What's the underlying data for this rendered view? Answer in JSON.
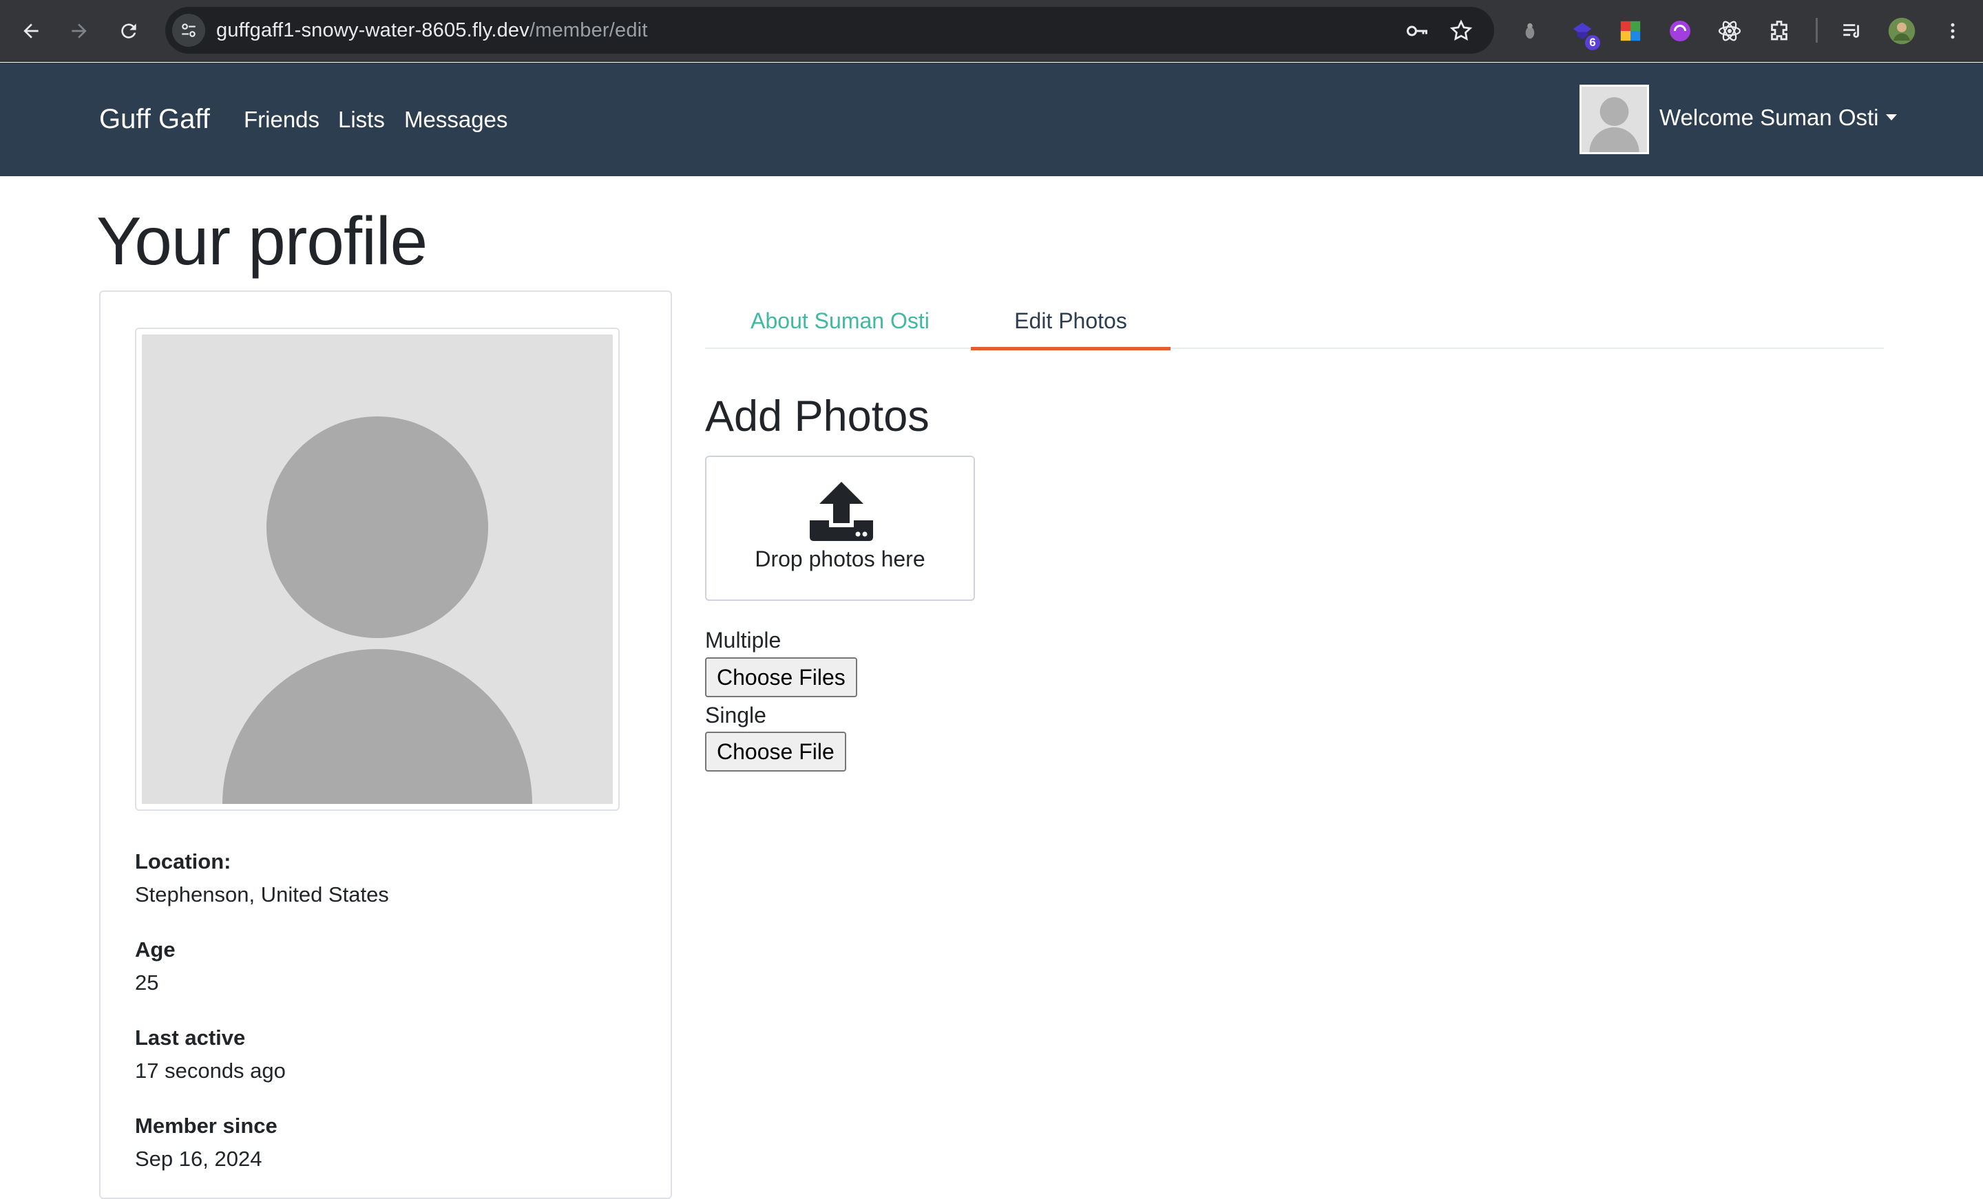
{
  "browser": {
    "url_host": "guffgaff1-snowy-water-8605.fly.dev",
    "url_path": "/member/edit",
    "extension_badge": "6"
  },
  "navbar": {
    "brand": "Guff Gaff",
    "links": [
      "Friends",
      "Lists",
      "Messages"
    ],
    "welcome": "Welcome Suman Osti"
  },
  "page": {
    "title": "Your profile"
  },
  "profile": {
    "location_label": "Location:",
    "location_value": "Stephenson, United States",
    "age_label": "Age",
    "age_value": "25",
    "last_active_label": "Last active",
    "last_active_value": "17 seconds ago",
    "member_since_label": "Member since",
    "member_since_value": "Sep 16, 2024"
  },
  "tabs": {
    "about": "About Suman Osti",
    "photos": "Edit Photos"
  },
  "photos": {
    "heading": "Add Photos",
    "drop_text": "Drop photos here",
    "multiple_label": "Multiple",
    "multiple_button": "Choose Files",
    "single_label": "Single",
    "single_button": "Choose File"
  },
  "colors": {
    "navbar_bg": "#2c3e50",
    "tab_inactive": "#3fb9a0",
    "tab_active_underline": "#e55c30"
  }
}
